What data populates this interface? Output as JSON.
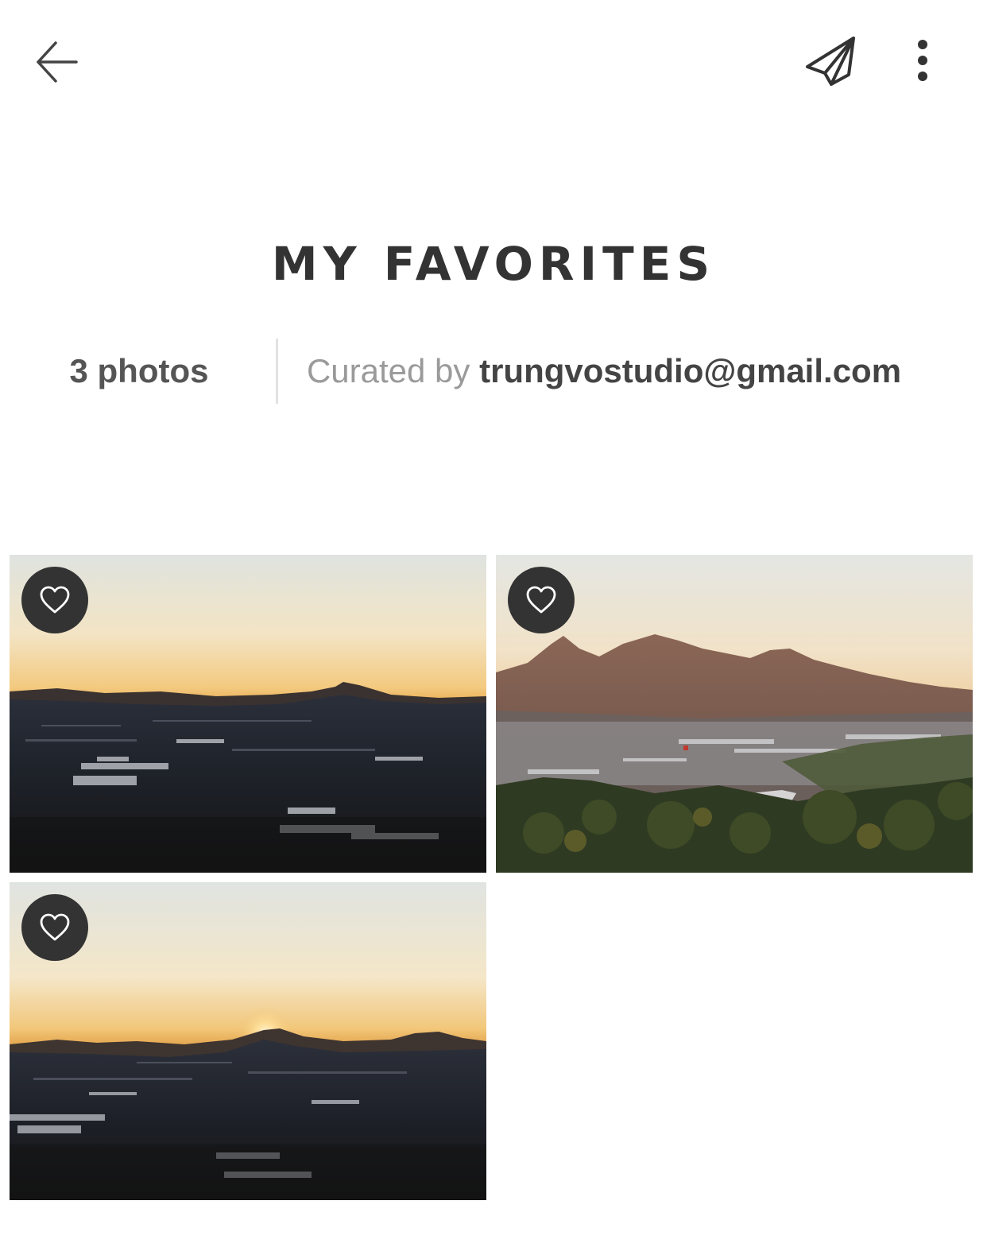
{
  "header": {
    "back_icon": "arrow-left-icon",
    "share_icon": "paper-plane-icon",
    "menu_icon": "more-vertical-icon"
  },
  "collection": {
    "title": "MY FAVORITES",
    "photo_count": "3 photos",
    "curated_label": "Curated by",
    "curator": "trungvostudio@gmail.com"
  },
  "photos": [
    {
      "favorite_icon": "heart-outline-icon"
    },
    {
      "favorite_icon": "heart-outline-icon"
    },
    {
      "favorite_icon": "heart-outline-icon"
    }
  ],
  "colors": {
    "text": "#333333",
    "muted": "#9a9a9a",
    "badge_bg": "#333333"
  }
}
